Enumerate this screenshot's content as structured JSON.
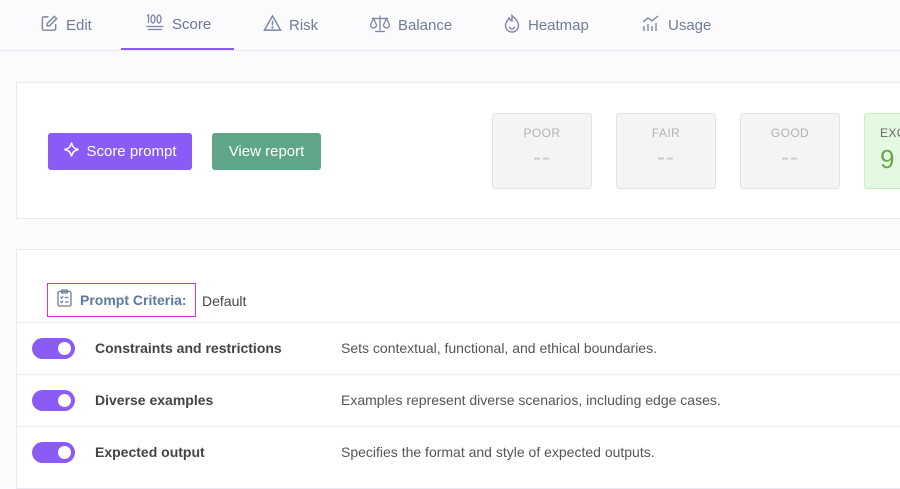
{
  "tabs": [
    {
      "label": "Edit",
      "icon": "edit-icon"
    },
    {
      "label": "Score",
      "icon": "hundred-points-icon"
    },
    {
      "label": "Risk",
      "icon": "warning-icon"
    },
    {
      "label": "Balance",
      "icon": "balance-scale-icon"
    },
    {
      "label": "Heatmap",
      "icon": "heatmap-icon"
    },
    {
      "label": "Usage",
      "icon": "usage-chart-icon"
    }
  ],
  "active_tab": "Score",
  "actions": {
    "score_label": "Score prompt",
    "report_label": "View report"
  },
  "grades": [
    {
      "label": "POOR",
      "value": "--"
    },
    {
      "label": "FAIR",
      "value": "--"
    },
    {
      "label": "GOOD",
      "value": "--"
    },
    {
      "label": "EXC",
      "value": "9"
    }
  ],
  "criteria": {
    "title": "Prompt Criteria:",
    "value": "Default",
    "items": [
      {
        "name": "Constraints and restrictions",
        "description": "Sets contextual, functional, and ethical boundaries.",
        "enabled": true
      },
      {
        "name": "Diverse examples",
        "description": "Examples represent diverse scenarios, including edge cases.",
        "enabled": true
      },
      {
        "name": "Expected output",
        "description": "Specifies the format and style of expected outputs.",
        "enabled": true
      }
    ]
  },
  "colors": {
    "accent": "#8a5cf5",
    "report_button": "#5fa587",
    "excellent_bg": "#e5f9e2",
    "excellent_text": "#6aa847",
    "criteria_highlight": "#e035c8"
  }
}
